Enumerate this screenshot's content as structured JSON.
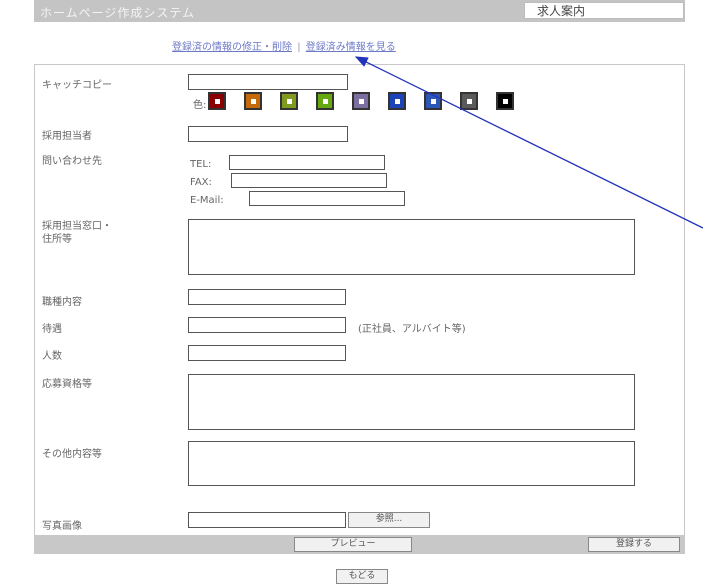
{
  "header": {
    "title": "ホームページ作成システム",
    "right_label": "求人案内"
  },
  "top_links": {
    "edit_delete": "登録済の情報の修正・削除",
    "separator": "|",
    "view": "登録済み情報を見る"
  },
  "form": {
    "catch_copy_label": "キャッチコピー",
    "color_label": "色:",
    "colors": [
      "#8a0000",
      "#c46a0a",
      "#7f9a1e",
      "#66a80f",
      "#7a6f9e",
      "#1c44b8",
      "#2c56b8",
      "#5a5a5a",
      "#000000"
    ],
    "staff_label": "採用担当者",
    "contact_label": "問い合わせ先",
    "tel_label": "TEL:",
    "fax_label": "FAX:",
    "email_label": "E-Mail:",
    "address_label_line1": "採用担当窓口・",
    "address_label_line2": "住所等",
    "job_label": "職種内容",
    "employment_label": "待遇",
    "employment_note": "(正社員、アルバイト等)",
    "count_label": "人数",
    "requirements_label": "応募資格等",
    "other_label": "その他内容等",
    "image_label": "写真画像",
    "browse_button": "参照..."
  },
  "buttons": {
    "preview": "プレビュー",
    "register": "登録する",
    "back": "もどる"
  }
}
